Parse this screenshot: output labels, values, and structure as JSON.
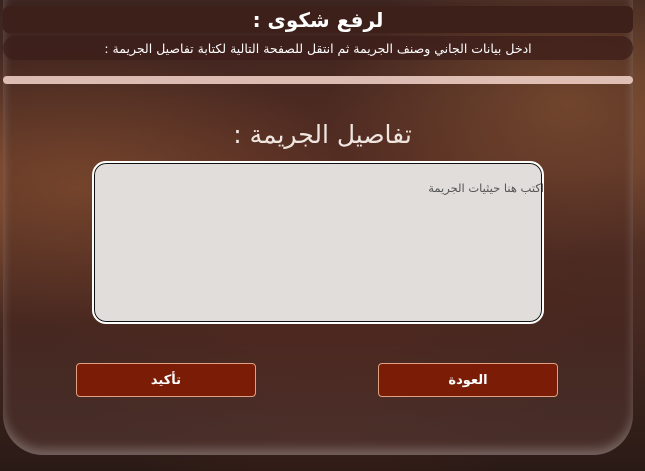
{
  "header": {
    "title": "لرفع شكوى :",
    "instructions": "ادخل بيانات الجاني وصنف الجريمة ثم انتقل للصفحة التالية لكتابة تفاصيل الجريمة :"
  },
  "progress": {
    "fraction": 1.0
  },
  "form": {
    "section_heading": "تفاصيل الجريمة :",
    "details_value": "",
    "details_placeholder": "اكتب هنا حيثيات الجريمة"
  },
  "actions": {
    "confirm_label": "تأكيد",
    "back_label": "العودة"
  },
  "colors": {
    "button_bg": "#7b1c07",
    "title_bar_bg": "#3d2019"
  }
}
